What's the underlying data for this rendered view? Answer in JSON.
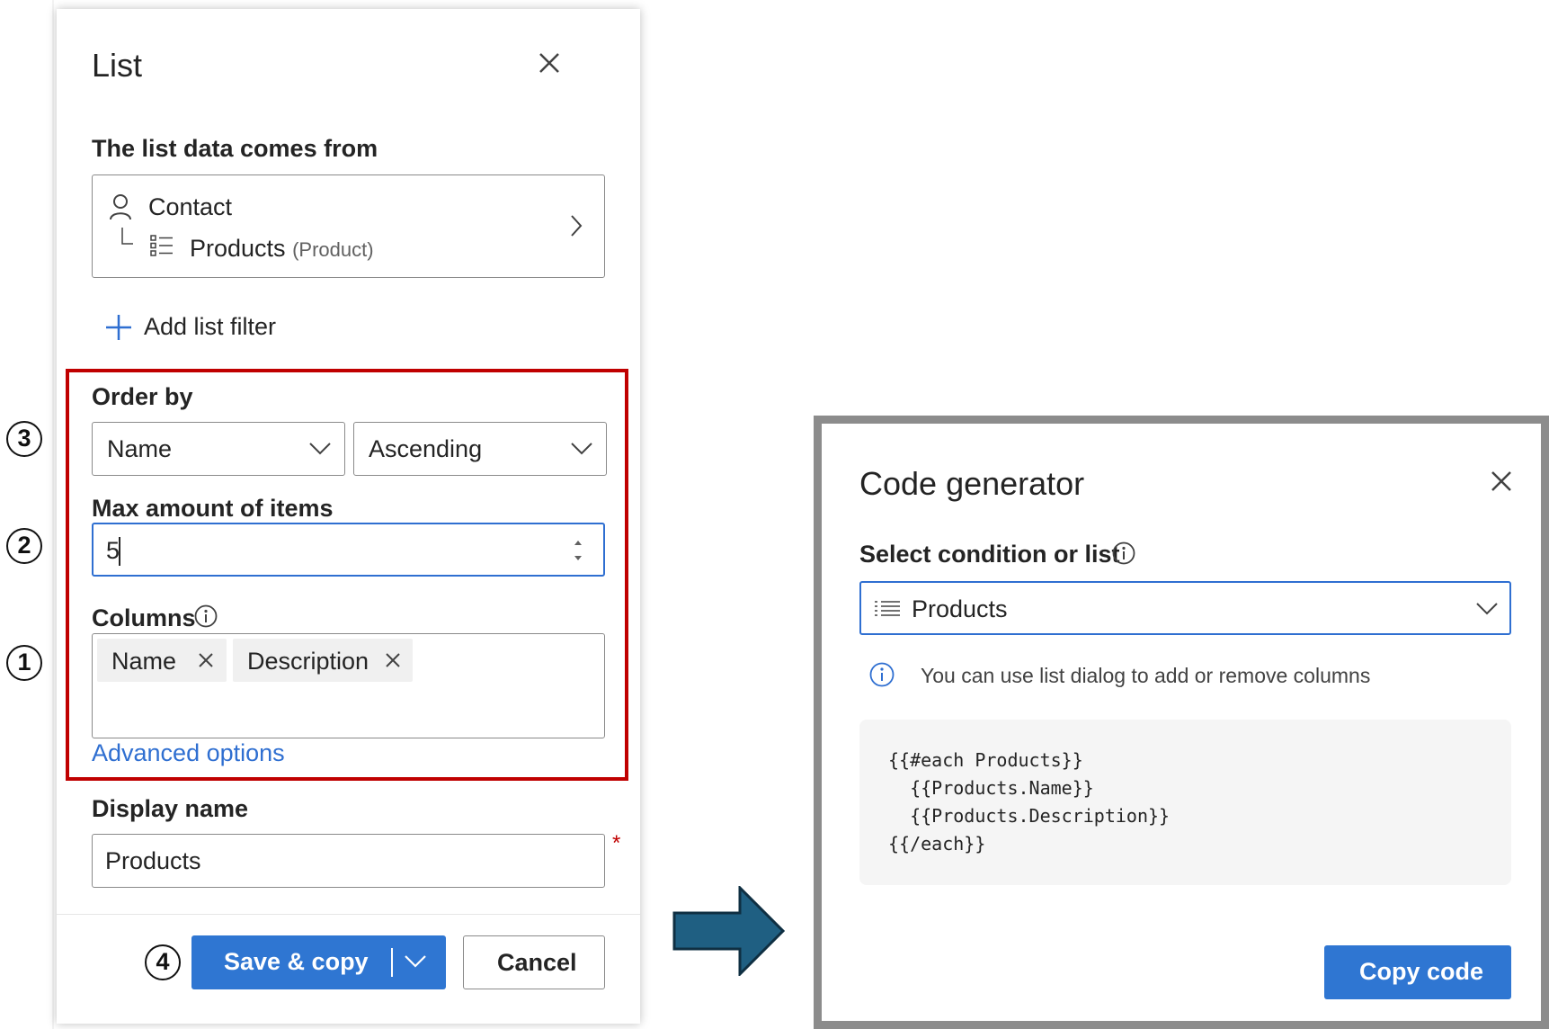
{
  "list_panel": {
    "title": "List",
    "data_source_label": "The list data comes from",
    "source_entity": "Contact",
    "source_relation": "Products",
    "source_relation_type": "(Product)",
    "add_filter_label": "Add list filter",
    "order_by_label": "Order by",
    "order_field": "Name",
    "order_direction": "Ascending",
    "max_items_label": "Max amount of items",
    "max_items_value": "5",
    "columns_label": "Columns",
    "columns": [
      "Name",
      "Description"
    ],
    "advanced_options": "Advanced options",
    "display_name_label": "Display name",
    "display_name_value": "Products",
    "required_marker": "*",
    "save_button": "Save & copy",
    "cancel_button": "Cancel"
  },
  "steps": [
    "3",
    "2",
    "1",
    "4"
  ],
  "code_generator": {
    "title": "Code generator",
    "select_label": "Select condition or list",
    "selected_value": "Products",
    "info_text": "You can use list dialog to add or remove columns",
    "code_lines": [
      "{{#each Products}}",
      "  {{Products.Name}}",
      "  {{Products.Description}}",
      "{{/each}}"
    ],
    "copy_button": "Copy code"
  },
  "colors": {
    "accent": "#2f76d2",
    "highlight": "#c00000",
    "arrow": "#1f5f82"
  }
}
